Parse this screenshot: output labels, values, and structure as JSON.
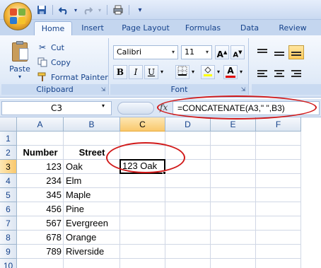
{
  "quick_access": {
    "items": [
      {
        "name": "save-icon",
        "glyph": "💾"
      },
      {
        "name": "undo-icon",
        "glyph": "↶"
      },
      {
        "name": "dropdown-icon",
        "glyph": "▾"
      },
      {
        "name": "redo-icon",
        "glyph": "↷"
      },
      {
        "name": "dropdown-icon",
        "glyph": "▾"
      },
      {
        "name": "print-icon",
        "glyph": "🖶"
      },
      {
        "name": "customize-icon",
        "glyph": "⁼"
      }
    ]
  },
  "tabs": [
    "Home",
    "Insert",
    "Page Layout",
    "Formulas",
    "Data",
    "Review"
  ],
  "active_tab": "Home",
  "clipboard": {
    "paste": "Paste",
    "cut": "Cut",
    "copy": "Copy",
    "format_painter": "Format Painter",
    "label": "Clipboard"
  },
  "font": {
    "family": "Calibri",
    "size": "11",
    "bold": "B",
    "italic": "I",
    "underline": "U",
    "grow": "A",
    "shrink": "A",
    "color_letter": "A",
    "label": "Font",
    "fill_color": "#ffff00",
    "font_color": "#e00000"
  },
  "formula_bar": {
    "name_box": "C3",
    "fx": "fx",
    "formula": "=CONCATENATE(A3,\" \",B3)"
  },
  "sheet": {
    "columns": [
      "A",
      "B",
      "C",
      "D",
      "E",
      "F"
    ],
    "selected_column": "C",
    "rows": [
      "1",
      "2",
      "3",
      "4",
      "5",
      "6",
      "7",
      "8",
      "9",
      "10"
    ],
    "selected_row": "3",
    "headers": {
      "number": "Number",
      "street": "Street"
    },
    "data": [
      {
        "row": "3",
        "number": "123",
        "street": "Oak",
        "c": "123 Oak"
      },
      {
        "row": "4",
        "number": "234",
        "street": "Elm"
      },
      {
        "row": "5",
        "number": "345",
        "street": "Maple"
      },
      {
        "row": "6",
        "number": "456",
        "street": "Pine"
      },
      {
        "row": "7",
        "number": "567",
        "street": "Evergreen"
      },
      {
        "row": "8",
        "number": "678",
        "street": "Orange"
      },
      {
        "row": "9",
        "number": "789",
        "street": "Riverside"
      }
    ]
  },
  "colors": {
    "annotation": "#d11a1a",
    "accent": "#15428b"
  }
}
